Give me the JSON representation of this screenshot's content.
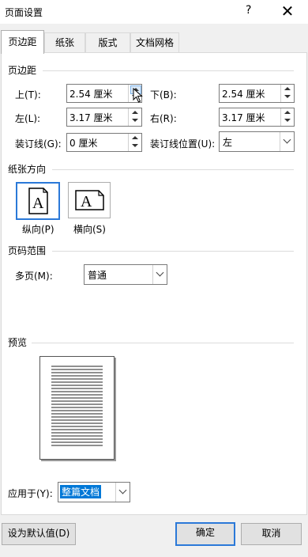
{
  "window": {
    "title": "页面设置",
    "help_label": "?",
    "close_label": "✕"
  },
  "tabs": [
    {
      "label": "页边距",
      "active": true
    },
    {
      "label": "纸张",
      "active": false
    },
    {
      "label": "版式",
      "active": false
    },
    {
      "label": "文档网格",
      "active": false
    }
  ],
  "margins": {
    "section_title": "页边距",
    "top": {
      "label": "上(T):",
      "value": "2.54 厘米"
    },
    "bottom": {
      "label": "下(B):",
      "value": "2.54 厘米"
    },
    "left": {
      "label": "左(L):",
      "value": "3.17 厘米"
    },
    "right": {
      "label": "右(R):",
      "value": "3.17 厘米"
    },
    "gutter": {
      "label": "装订线(G):",
      "value": "0 厘米"
    },
    "gutter_position": {
      "label": "装订线位置(U):",
      "value": "左"
    }
  },
  "orientation": {
    "section_title": "纸张方向",
    "portrait": {
      "label": "纵向(P)",
      "glyph": "A",
      "selected": true
    },
    "landscape": {
      "label": "横向(S)",
      "glyph": "A",
      "selected": false
    }
  },
  "pages": {
    "section_title": "页码范围",
    "multiple_label": "多页(M):",
    "multiple_value": "普通"
  },
  "preview": {
    "section_title": "预览"
  },
  "apply_to": {
    "label": "应用于(Y):",
    "value": "整篇文档"
  },
  "buttons": {
    "default_label": "设为默认值(D)",
    "ok_label": "确定",
    "cancel_label": "取消"
  },
  "colors": {
    "accent": "#2b79d8",
    "selection": "#0078d7"
  }
}
